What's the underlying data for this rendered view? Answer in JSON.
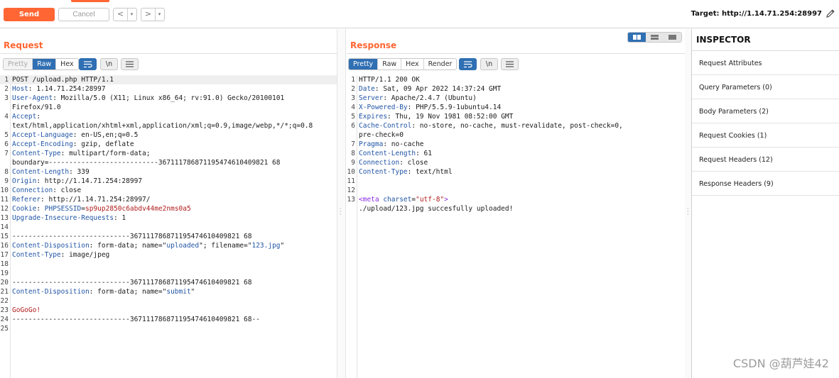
{
  "toolbar": {
    "send_label": "Send",
    "cancel_label": "Cancel",
    "back_glyph": "<",
    "forward_glyph": ">",
    "dropdown_glyph": "▾",
    "target_text": "Target: http://1.14.71.254:28997",
    "accent_color": "#ff6633"
  },
  "request": {
    "title": "Request",
    "tabs": [
      "Pretty",
      "Raw",
      "Hex"
    ],
    "active_tab": "Raw",
    "newline_toggle": "\\n",
    "lines": [
      {
        "n": "1",
        "parts": [
          {
            "t": "POST /upload.php HTTP/1.1",
            "c": "val"
          }
        ]
      },
      {
        "n": "2",
        "parts": [
          {
            "t": "Host",
            "c": "hn"
          },
          {
            "t": ": 1.14.71.254:28997",
            "c": "val"
          }
        ]
      },
      {
        "n": "3",
        "parts": [
          {
            "t": "User-Agent",
            "c": "hn"
          },
          {
            "t": ": Mozilla/5.0 (X11; Linux x86_64; rv:91.0) Gecko/20100101",
            "c": "val"
          }
        ]
      },
      {
        "n": "",
        "parts": [
          {
            "t": "Firefox/91.0",
            "c": "val"
          }
        ]
      },
      {
        "n": "4",
        "parts": [
          {
            "t": "Accept",
            "c": "hn"
          },
          {
            "t": ":",
            "c": "val"
          }
        ]
      },
      {
        "n": "",
        "parts": [
          {
            "t": "text/html,application/xhtml+xml,application/xml;q=0.9,image/webp,*/*;q=0.8",
            "c": "val"
          }
        ]
      },
      {
        "n": "5",
        "parts": [
          {
            "t": "Accept-Language",
            "c": "hn"
          },
          {
            "t": ": en-US,en;q=0.5",
            "c": "val"
          }
        ]
      },
      {
        "n": "6",
        "parts": [
          {
            "t": "Accept-Encoding",
            "c": "hn"
          },
          {
            "t": ": gzip, deflate",
            "c": "val"
          }
        ]
      },
      {
        "n": "7",
        "parts": [
          {
            "t": "Content-Type",
            "c": "hn"
          },
          {
            "t": ": multipart/form-data;",
            "c": "val"
          }
        ]
      },
      {
        "n": "",
        "parts": [
          {
            "t": "boundary=---------------------------367111786871195474610409821 68",
            "c": "val"
          }
        ]
      },
      {
        "n": "8",
        "parts": [
          {
            "t": "Content-Length",
            "c": "hn"
          },
          {
            "t": ": 339",
            "c": "val"
          }
        ]
      },
      {
        "n": "9",
        "parts": [
          {
            "t": "Origin",
            "c": "hn"
          },
          {
            "t": ": http://1.14.71.254:28997",
            "c": "val"
          }
        ]
      },
      {
        "n": "10",
        "parts": [
          {
            "t": "Connection",
            "c": "hn"
          },
          {
            "t": ": close",
            "c": "val"
          }
        ]
      },
      {
        "n": "11",
        "parts": [
          {
            "t": "Referer",
            "c": "hn"
          },
          {
            "t": ": http://1.14.71.254:28997/",
            "c": "val"
          }
        ]
      },
      {
        "n": "12",
        "parts": [
          {
            "t": "Cookie",
            "c": "hn"
          },
          {
            "t": ": ",
            "c": "val"
          },
          {
            "t": "PHPSESSID",
            "c": "hn"
          },
          {
            "t": "=",
            "c": "val"
          },
          {
            "t": "sp9up2850c6abdv44me2nms0a5",
            "c": "red"
          }
        ]
      },
      {
        "n": "13",
        "parts": [
          {
            "t": "Upgrade-Insecure-Requests",
            "c": "hn"
          },
          {
            "t": ": 1",
            "c": "val"
          }
        ]
      },
      {
        "n": "14",
        "parts": []
      },
      {
        "n": "15",
        "parts": [
          {
            "t": "-----------------------------367111786871195474610409821 68",
            "c": "val"
          }
        ]
      },
      {
        "n": "16",
        "parts": [
          {
            "t": "Content-Disposition",
            "c": "hn"
          },
          {
            "t": ": form-data; name=\"",
            "c": "val"
          },
          {
            "t": "uploaded",
            "c": "str"
          },
          {
            "t": "\"; filename=\"",
            "c": "val"
          },
          {
            "t": "123.jpg",
            "c": "str"
          },
          {
            "t": "\"",
            "c": "val"
          }
        ]
      },
      {
        "n": "17",
        "parts": [
          {
            "t": "Content-Type",
            "c": "hn"
          },
          {
            "t": ": image/jpeg",
            "c": "val"
          }
        ]
      },
      {
        "n": "18",
        "parts": []
      },
      {
        "n": "19",
        "parts": []
      },
      {
        "n": "20",
        "parts": [
          {
            "t": "-----------------------------367111786871195474610409821 68",
            "c": "val"
          }
        ]
      },
      {
        "n": "21",
        "parts": [
          {
            "t": "Content-Disposition",
            "c": "hn"
          },
          {
            "t": ": form-data; name=\"",
            "c": "val"
          },
          {
            "t": "submit",
            "c": "str"
          },
          {
            "t": "\"",
            "c": "val"
          }
        ]
      },
      {
        "n": "22",
        "parts": []
      },
      {
        "n": "23",
        "parts": [
          {
            "t": "GoGoGo!",
            "c": "red"
          }
        ]
      },
      {
        "n": "24",
        "parts": [
          {
            "t": "-----------------------------367111786871195474610409821 68--",
            "c": "val"
          }
        ]
      },
      {
        "n": "25",
        "parts": []
      }
    ]
  },
  "response": {
    "title": "Response",
    "tabs": [
      "Pretty",
      "Raw",
      "Hex",
      "Render"
    ],
    "active_tab": "Pretty",
    "newline_toggle": "\\n",
    "lines": [
      {
        "n": "1",
        "parts": [
          {
            "t": "HTTP/1.1 200 OK",
            "c": "val"
          }
        ]
      },
      {
        "n": "2",
        "parts": [
          {
            "t": "Date",
            "c": "hn"
          },
          {
            "t": ": Sat, 09 Apr 2022 14:37:24 GMT",
            "c": "val"
          }
        ]
      },
      {
        "n": "3",
        "parts": [
          {
            "t": "Server",
            "c": "hn"
          },
          {
            "t": ": Apache/2.4.7 (Ubuntu)",
            "c": "val"
          }
        ]
      },
      {
        "n": "4",
        "parts": [
          {
            "t": "X-Powered-By",
            "c": "hn"
          },
          {
            "t": ": PHP/5.5.9-1ubuntu4.14",
            "c": "val"
          }
        ]
      },
      {
        "n": "5",
        "parts": [
          {
            "t": "Expires",
            "c": "hn"
          },
          {
            "t": ": Thu, 19 Nov 1981 08:52:00 GMT",
            "c": "val"
          }
        ]
      },
      {
        "n": "6",
        "parts": [
          {
            "t": "Cache-Control",
            "c": "hn"
          },
          {
            "t": ": no-store, no-cache, must-revalidate, post-check=0,",
            "c": "val"
          }
        ]
      },
      {
        "n": "",
        "parts": [
          {
            "t": "pre-check=0",
            "c": "val"
          }
        ]
      },
      {
        "n": "7",
        "parts": [
          {
            "t": "Pragma",
            "c": "hn"
          },
          {
            "t": ": no-cache",
            "c": "val"
          }
        ]
      },
      {
        "n": "8",
        "parts": [
          {
            "t": "Content-Length",
            "c": "hn"
          },
          {
            "t": ": 61",
            "c": "val"
          }
        ]
      },
      {
        "n": "9",
        "parts": [
          {
            "t": "Connection",
            "c": "hn"
          },
          {
            "t": ": close",
            "c": "val"
          }
        ]
      },
      {
        "n": "10",
        "parts": [
          {
            "t": "Content-Type",
            "c": "hn"
          },
          {
            "t": ": text/html",
            "c": "val"
          }
        ]
      },
      {
        "n": "11",
        "parts": []
      },
      {
        "n": "12",
        "parts": []
      },
      {
        "n": "13",
        "parts": [
          {
            "t": "<meta ",
            "c": "tag"
          },
          {
            "t": "charset",
            "c": "hn"
          },
          {
            "t": "=",
            "c": "val"
          },
          {
            "t": "\"utf-8\"",
            "c": "red"
          },
          {
            "t": ">",
            "c": "tag"
          }
        ]
      },
      {
        "n": "",
        "parts": [
          {
            "t": "./upload/123.jpg succesfully uploaded!",
            "c": "val"
          }
        ]
      }
    ]
  },
  "inspector": {
    "title": "INSPECTOR",
    "items": [
      "Request Attributes",
      "Query Parameters (0)",
      "Body Parameters (2)",
      "Request Cookies (1)",
      "Request Headers (12)",
      "Response Headers (9)"
    ]
  },
  "watermark": "CSDN @葫芦娃42"
}
